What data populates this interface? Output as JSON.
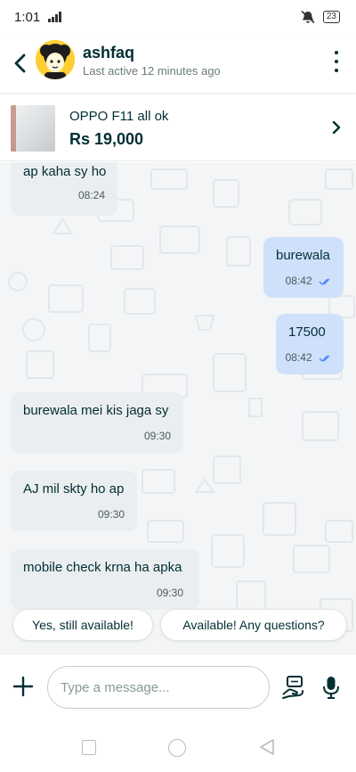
{
  "status_bar": {
    "time": "1:01",
    "battery": "23"
  },
  "header": {
    "user_name": "ashfaq",
    "last_active": "Last active 12 minutes ago"
  },
  "product": {
    "title": "OPPO F11 all ok",
    "price": "Rs 19,000"
  },
  "messages": [
    {
      "direction": "incoming",
      "text": "ap kaha sy ho",
      "time": "08:24"
    },
    {
      "direction": "outgoing",
      "text": "burewala",
      "time": "08:42",
      "status": "read"
    },
    {
      "direction": "outgoing",
      "text": "17500",
      "time": "08:42",
      "status": "read"
    },
    {
      "direction": "incoming",
      "text": "burewala mei kis jaga sy",
      "time": "09:30"
    },
    {
      "direction": "incoming",
      "text": "AJ mil skty ho ap",
      "time": "09:30"
    },
    {
      "direction": "incoming",
      "text": "mobile check krna ha apka",
      "time": "09:30"
    }
  ],
  "quick_replies": [
    "Yes, still available!",
    "Available! Any questions?"
  ],
  "composer": {
    "placeholder": "Type a message...",
    "value": ""
  },
  "colors": {
    "brand_text": "#002f34",
    "outgoing_bubble": "#cfe0fb",
    "incoming_bubble": "#ebeef0",
    "read_ticks": "#3a77ff",
    "avatar_bg": "#ffce32"
  }
}
